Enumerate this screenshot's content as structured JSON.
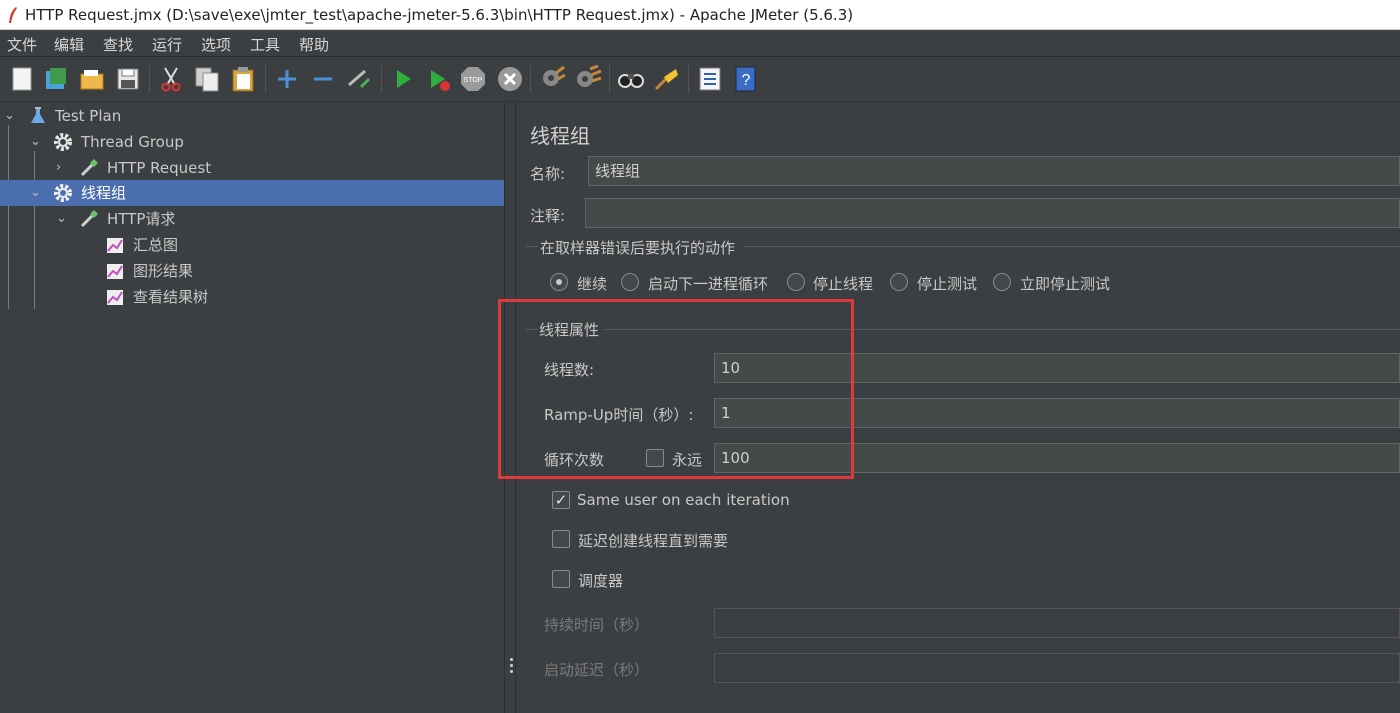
{
  "window": {
    "title": "HTTP Request.jmx (D:\\save\\exe\\jmter_test\\apache-jmeter-5.6.3\\bin\\HTTP Request.jmx) - Apache JMeter (5.6.3)"
  },
  "menu": [
    "文件",
    "编辑",
    "查找",
    "运行",
    "选项",
    "工具",
    "帮助"
  ],
  "toolbar_icons": [
    "new-icon",
    "templates-icon",
    "open-icon",
    "save-icon",
    "cut-icon",
    "copy-icon",
    "paste-icon",
    "expand-icon",
    "collapse-icon",
    "toggle-icon",
    "start-icon",
    "start-no-pause-icon",
    "stop-icon",
    "shutdown-icon",
    "clear-icon",
    "clear-all-icon",
    "search-icon",
    "reset-search-icon",
    "function-helper-icon",
    "help-icon"
  ],
  "tree": {
    "test_plan": "Test Plan",
    "thread_group": "Thread Group",
    "http_request": "HTTP Request",
    "thread_group_cn": "线程组",
    "http_request_cn": "HTTP请求",
    "listener_summary": "汇总图",
    "listener_graph": "图形结果",
    "listener_tree": "查看结果树"
  },
  "panel": {
    "title": "线程组",
    "name_label": "名称:",
    "name_value": "线程组",
    "comment_label": "注释:",
    "comment_value": "",
    "error_action_legend": "在取样器错误后要执行的动作",
    "actions": [
      {
        "label": "继续",
        "selected": true
      },
      {
        "label": "启动下一进程循环",
        "selected": false
      },
      {
        "label": "停止线程",
        "selected": false
      },
      {
        "label": "停止测试",
        "selected": false
      },
      {
        "label": "立即停止测试",
        "selected": false
      }
    ],
    "thread_props_legend": "线程属性",
    "threads_label": "线程数:",
    "threads_value": "10",
    "rampup_label": "Ramp-Up时间（秒）:",
    "rampup_value": "1",
    "loop_label": "循环次数",
    "forever_label": "永远",
    "forever_checked": false,
    "loop_value": "100",
    "same_user_label": "Same user on each iteration",
    "same_user_checked": true,
    "delay_label": "延迟创建线程直到需要",
    "delay_checked": false,
    "scheduler_label": "调度器",
    "scheduler_checked": false,
    "duration_label": "持续时间（秒）",
    "duration_value": "",
    "startup_delay_label": "启动延迟（秒）",
    "startup_delay_value": ""
  },
  "colors": {
    "background": "#3c3f41",
    "selection": "#4b6eaf",
    "highlight_box": "#e0393b"
  }
}
